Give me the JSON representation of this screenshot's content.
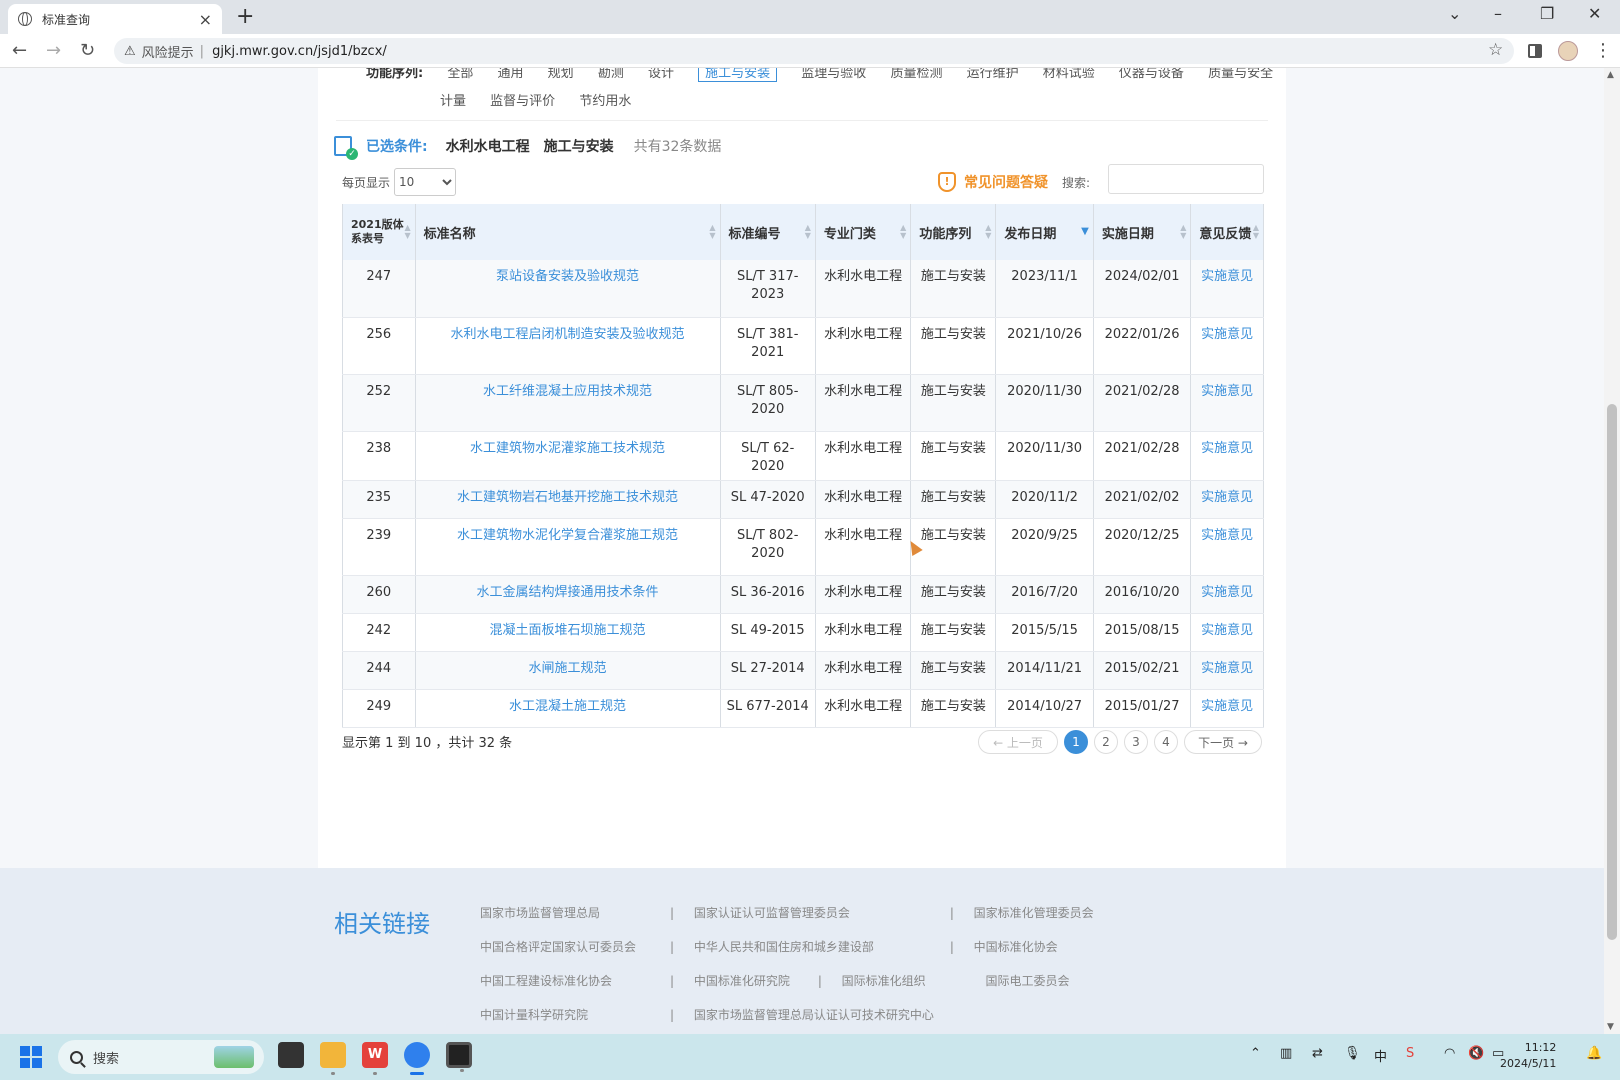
{
  "browser": {
    "tab_title": "标准查询",
    "address_warning": "风险提示",
    "url": "gjkj.mwr.gov.cn/jsjd1/bzcx/"
  },
  "filters": {
    "row1_label": "功能序列:",
    "row1_items": [
      "全部",
      "通用",
      "规划",
      "勘测",
      "设计",
      "施工与安装",
      "监理与验收",
      "质量检测",
      "运行维护",
      "材料试验",
      "仪器与设备",
      "质量与安全"
    ],
    "row2_items": [
      "计量",
      "监督与评价",
      "节约用水"
    ]
  },
  "selected": {
    "label": "已选条件:",
    "conditions": [
      "水利水电工程",
      "施工与安装"
    ],
    "count": "共有32条数据"
  },
  "per_page": {
    "label": "每页显示",
    "value": "10"
  },
  "faq": {
    "label": "常见问题答疑"
  },
  "search": {
    "label": "搜索:",
    "value": ""
  },
  "table": {
    "headers": [
      "2021版体系表号",
      "标准名称",
      "标准编号",
      "专业门类",
      "功能序列",
      "发布日期",
      "实施日期",
      "意见反馈"
    ],
    "rows": [
      {
        "no": "247",
        "name": "泵站设备安装及验收规范",
        "code": "SL/T 317-2023",
        "cat": "水利水电工程",
        "func": "施工与安装",
        "pub": "2023/11/1",
        "impl": "2024/02/01",
        "fb": "实施意见",
        "tall": true
      },
      {
        "no": "256",
        "name": "水利水电工程启闭机制造安装及验收规范",
        "code": "SL/T 381-2021",
        "cat": "水利水电工程",
        "func": "施工与安装",
        "pub": "2021/10/26",
        "impl": "2022/01/26",
        "fb": "实施意见",
        "tall": true
      },
      {
        "no": "252",
        "name": "水工纤维混凝土应用技术规范",
        "code": "SL/T 805-2020",
        "cat": "水利水电工程",
        "func": "施工与安装",
        "pub": "2020/11/30",
        "impl": "2021/02/28",
        "fb": "实施意见",
        "tall": true
      },
      {
        "no": "238",
        "name": "水工建筑物水泥灌浆施工技术规范",
        "code": "SL/T 62-2020",
        "cat": "水利水电工程",
        "func": "施工与安装",
        "pub": "2020/11/30",
        "impl": "2021/02/28",
        "fb": "实施意见",
        "tall": false
      },
      {
        "no": "235",
        "name": "水工建筑物岩石地基开挖施工技术规范",
        "code": "SL 47-2020",
        "cat": "水利水电工程",
        "func": "施工与安装",
        "pub": "2020/11/2",
        "impl": "2021/02/02",
        "fb": "实施意见",
        "tall": false
      },
      {
        "no": "239",
        "name": "水工建筑物水泥化学复合灌浆施工规范",
        "code": "SL/T 802-2020",
        "cat": "水利水电工程",
        "func": "施工与安装",
        "pub": "2020/9/25",
        "impl": "2020/12/25",
        "fb": "实施意见",
        "tall": true
      },
      {
        "no": "260",
        "name": "水工金属结构焊接通用技术条件",
        "code": "SL 36-2016",
        "cat": "水利水电工程",
        "func": "施工与安装",
        "pub": "2016/7/20",
        "impl": "2016/10/20",
        "fb": "实施意见",
        "tall": false
      },
      {
        "no": "242",
        "name": "混凝土面板堆石坝施工规范",
        "code": "SL 49-2015",
        "cat": "水利水电工程",
        "func": "施工与安装",
        "pub": "2015/5/15",
        "impl": "2015/08/15",
        "fb": "实施意见",
        "tall": false
      },
      {
        "no": "244",
        "name": "水闸施工规范",
        "code": "SL 27-2014",
        "cat": "水利水电工程",
        "func": "施工与安装",
        "pub": "2014/11/21",
        "impl": "2015/02/21",
        "fb": "实施意见",
        "tall": false
      },
      {
        "no": "249",
        "name": "水工混凝土施工规范",
        "code": "SL 677-2014",
        "cat": "水利水电工程",
        "func": "施工与安装",
        "pub": "2014/10/27",
        "impl": "2015/01/27",
        "fb": "实施意见",
        "tall": false
      }
    ]
  },
  "pagination": {
    "summary": "显示第 1 到 10 ，共计 32 条",
    "prev": "← 上一页",
    "next": "下一页 →",
    "pages": [
      "1",
      "2",
      "3",
      "4"
    ],
    "current": "1"
  },
  "footer": {
    "title": "相关链接",
    "links": [
      [
        "国家市场监督管理总局",
        "国家认证认可监督管理委员会",
        "国家标准化管理委员会"
      ],
      [
        "中国合格评定国家认可委员会",
        "中华人民共和国住房和城乡建设部",
        "中国标准化协会"
      ],
      [
        "中国工程建设标准化协会",
        "中国标准化研究院",
        "国际标准化组织",
        "国际电工委员会"
      ],
      [
        "中国计量科学研究院",
        "国家市场监督管理总局认证认可技术研究中心"
      ]
    ]
  },
  "taskbar": {
    "search_placeholder": "搜索",
    "time": "11:12",
    "date": "2024/5/11",
    "ime": "中"
  }
}
